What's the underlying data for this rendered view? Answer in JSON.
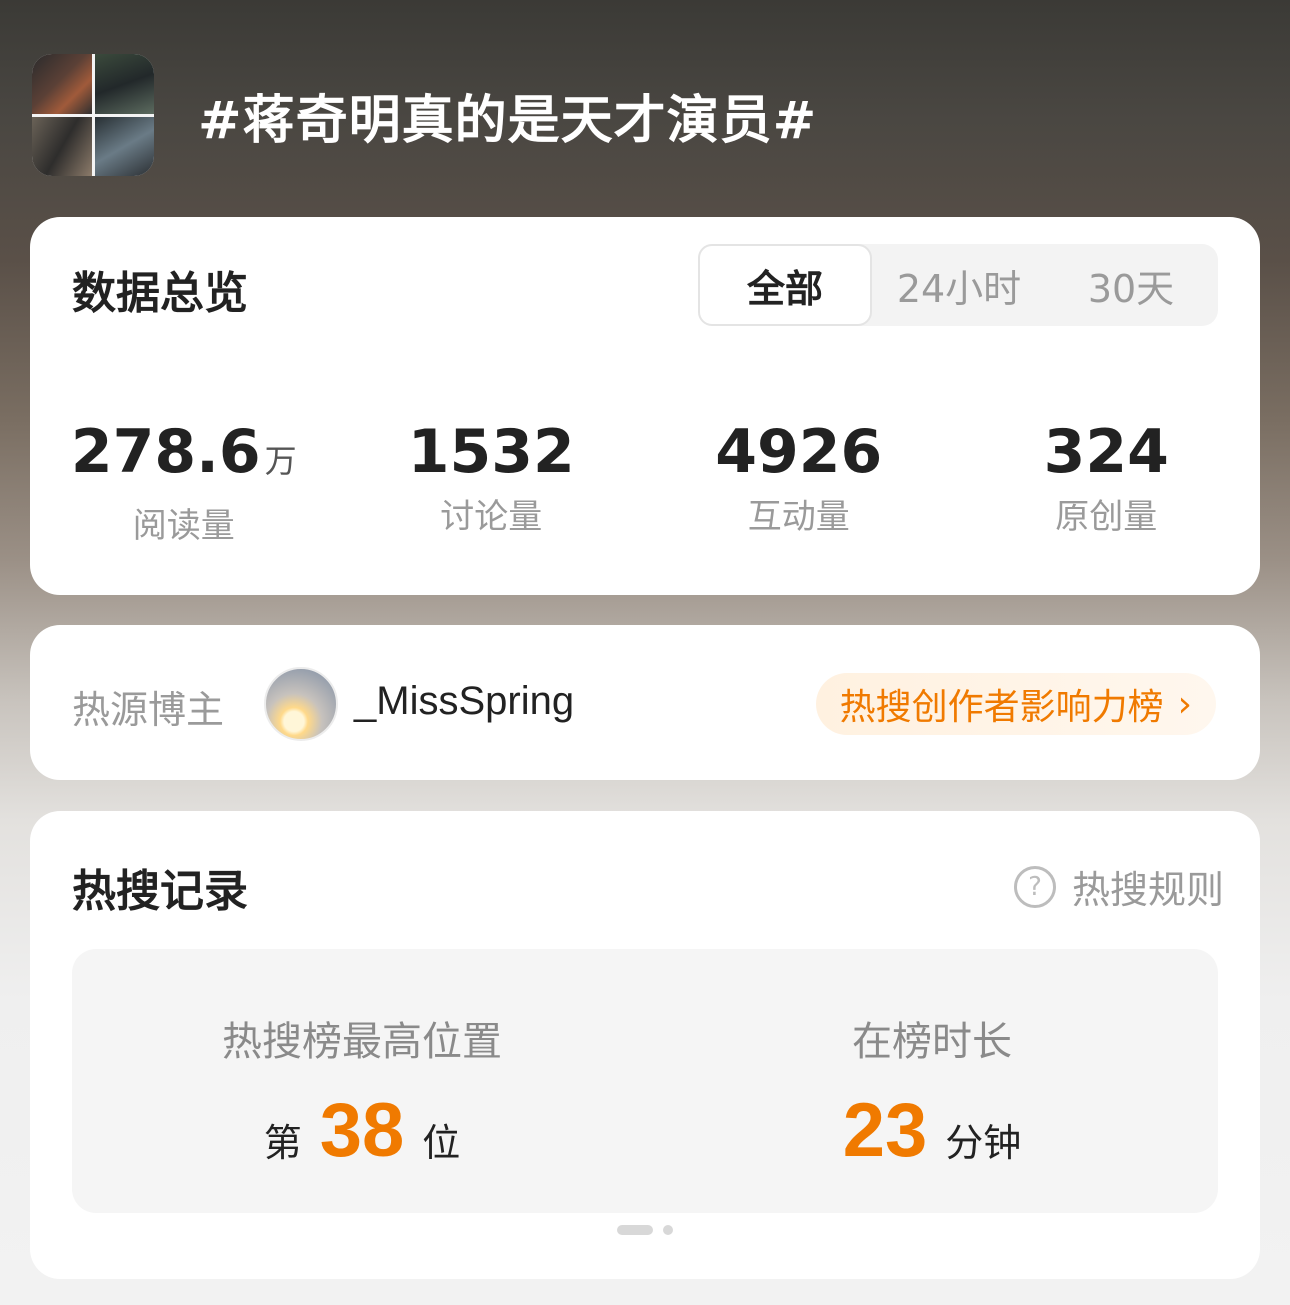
{
  "header": {
    "topic_title": "#蒋奇明真的是天才演员#"
  },
  "overview": {
    "title": "数据总览",
    "tabs": [
      "全部",
      "24小时",
      "30天"
    ],
    "active_tab": "全部",
    "stats": [
      {
        "value": "278.6",
        "unit": "万",
        "label": "阅读量"
      },
      {
        "value": "1532",
        "unit": "",
        "label": "讨论量"
      },
      {
        "value": "4926",
        "unit": "",
        "label": "互动量"
      },
      {
        "value": "324",
        "unit": "",
        "label": "原创量"
      }
    ]
  },
  "source": {
    "label": "热源博主",
    "username": "_MissSpring",
    "influence_link": "热搜创作者影响力榜"
  },
  "records": {
    "title": "热搜记录",
    "rules_link": "热搜规则",
    "peak": {
      "label": "热搜榜最高位置",
      "prefix": "第",
      "value": "38",
      "suffix": "位"
    },
    "duration": {
      "label": "在榜时长",
      "value": "23",
      "suffix": "分钟"
    }
  },
  "colors": {
    "accent": "#f07a00",
    "text": "#222222",
    "muted": "#9a9a9a"
  }
}
